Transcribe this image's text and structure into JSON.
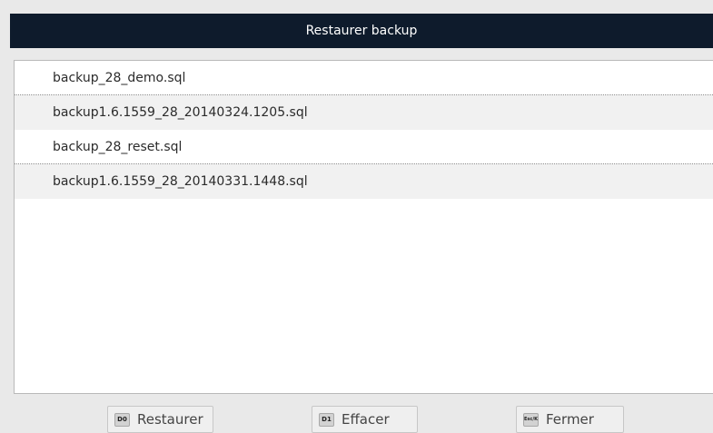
{
  "window": {
    "title": "Restaurer backup"
  },
  "backups": {
    "items": [
      "backup_28_demo.sql",
      "backup1.6.1559_28_20140324.1205.sql",
      "backup_28_reset.sql",
      "backup1.6.1559_28_20140331.1448.sql"
    ]
  },
  "buttons": {
    "restore": {
      "key": "D0",
      "label": "Restaurer"
    },
    "delete": {
      "key": "D1",
      "label": "Effacer"
    },
    "close": {
      "key": "Esc/K",
      "label": "Fermer"
    }
  }
}
